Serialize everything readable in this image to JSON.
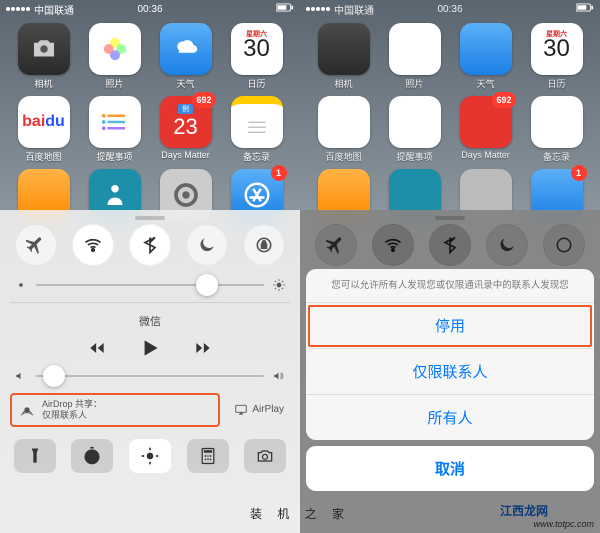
{
  "status": {
    "carrier": "中国联通",
    "time": "00:36",
    "battery": ""
  },
  "apps": {
    "r1": [
      {
        "key": "camera",
        "label": "相机",
        "bg": "bg-gray"
      },
      {
        "key": "photos",
        "label": "照片",
        "bg": "bg-white"
      },
      {
        "key": "weather",
        "label": "天气",
        "bg": "bg-blue"
      },
      {
        "key": "calendar",
        "label": "日历",
        "bg": "bg-white",
        "cal_weekday": "星期六",
        "cal_day": "30"
      }
    ],
    "r2": [
      {
        "key": "baidumap",
        "label": "百度地图",
        "bg": "bg-white"
      },
      {
        "key": "reminders",
        "label": "提醒事项",
        "bg": "bg-white"
      },
      {
        "key": "daysmatter",
        "label": "Days Matter",
        "bg": "bg-red",
        "dm_tag": "例",
        "dm_num": "23",
        "badge": "692"
      },
      {
        "key": "notes",
        "label": "备忘录",
        "bg": "bg-yellow"
      }
    ],
    "r3": [
      {
        "key": "calculator",
        "label": "",
        "bg": "bg-orange"
      },
      {
        "key": "health",
        "label": "",
        "bg": "bg-teal"
      },
      {
        "key": "settings",
        "label": "",
        "bg": "bg-gray"
      },
      {
        "key": "appstore",
        "label": "",
        "bg": "bg-blue",
        "badge": "1"
      }
    ]
  },
  "nowplaying": {
    "title": "微信"
  },
  "airdrop": {
    "line1": "AirDrop 共享：",
    "line2": "仅限联系人"
  },
  "airplay": "AirPlay",
  "sheet": {
    "prompt": "您可以允许所有人发现您或仅限通讯录中的联系人发现您",
    "option_off": "停用",
    "option_contacts": "仅限联系人",
    "option_everyone": "所有人",
    "cancel": "取消"
  },
  "footer": {
    "text": "装 机 之 家",
    "brand": "江西龙网",
    "url": "www.totpc.com"
  }
}
